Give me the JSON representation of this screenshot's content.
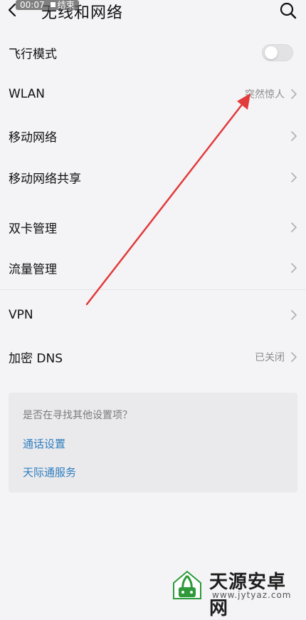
{
  "status": {
    "time": "00:07",
    "recording": "结束"
  },
  "header": {
    "title": "无线和网络"
  },
  "rows": [
    {
      "label": "飞行模式",
      "toggle": false
    },
    {
      "label": "WLAN",
      "value": "突然惊人"
    },
    {
      "label": "移动网络"
    },
    {
      "label": "移动网络共享"
    },
    {
      "label": "双卡管理"
    },
    {
      "label": "流量管理"
    },
    {
      "label": "VPN"
    },
    {
      "label": "加密 DNS",
      "value": "已关闭"
    }
  ],
  "suggest": {
    "title": "是否在寻找其他设置项？",
    "links": [
      "通话设置",
      "天际通服务"
    ]
  },
  "watermark": {
    "name": "天源安卓网",
    "url": "www.jytyaz.com"
  },
  "colors": {
    "link": "#2f7dbd",
    "annotation_arrow": "#e23b3b",
    "background": "#f4f4f6"
  }
}
